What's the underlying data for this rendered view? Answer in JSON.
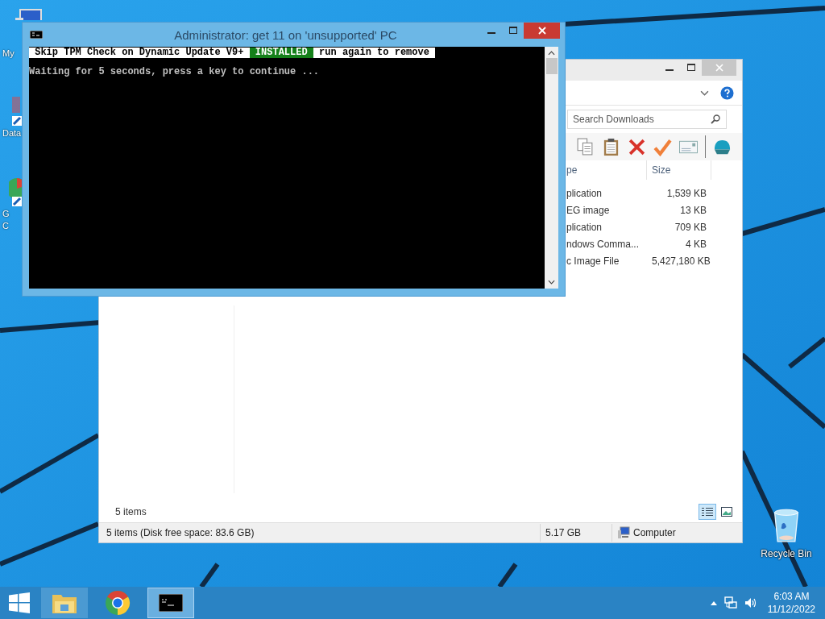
{
  "desktop_icons": [
    {
      "kind": "computer",
      "lines": [
        "My"
      ]
    },
    {
      "kind": "shortcut",
      "lines": [
        "Data"
      ]
    },
    {
      "kind": "chrome",
      "lines": [
        "G",
        "C"
      ]
    }
  ],
  "recycle_bin": {
    "label": "Recycle Bin"
  },
  "explorer": {
    "search": {
      "placeholder": "Search Downloads"
    },
    "columns": [
      {
        "label": "pe"
      },
      {
        "label": "Size"
      }
    ],
    "rows": [
      {
        "column_1": "plication",
        "size": "1,539 KB"
      },
      {
        "column_1": "EG image",
        "size": "13 KB"
      },
      {
        "column_1": "plication",
        "size": "709 KB"
      },
      {
        "column_1": "ndows Comma...",
        "size": "4 KB"
      },
      {
        "column_1": "c Image File",
        "size": "5,427,180 KB"
      }
    ],
    "item_count": "5 items",
    "views": [
      {
        "kind": "details",
        "selected": true
      },
      {
        "kind": "preview",
        "selected": false
      }
    ],
    "status_bar": {
      "summary": "5 items (Disk free space: 83.6 GB)",
      "size": "5.17 GB",
      "location": "Computer"
    }
  },
  "console": {
    "title": "Administrator:  get 11 on 'unsupported' PC",
    "banner": [
      {
        "text": " Skip TPM Check on Dynamic Update V9+ ",
        "kind": "plain"
      },
      {
        "text": " INSTALLED ",
        "kind": "installed"
      },
      {
        "text": " run again to remove ",
        "kind": "plain"
      }
    ],
    "lines": [
      "Waiting for 5 seconds, press a key to continue ..."
    ]
  },
  "taskbar": {
    "apps": [
      {
        "kind": "explorer",
        "open": true,
        "selected": false
      },
      {
        "kind": "chrome",
        "open": false,
        "selected": false
      },
      {
        "kind": "console",
        "open": true,
        "selected": true
      }
    ],
    "time": "6:03 AM",
    "date": "11/12/2022"
  }
}
